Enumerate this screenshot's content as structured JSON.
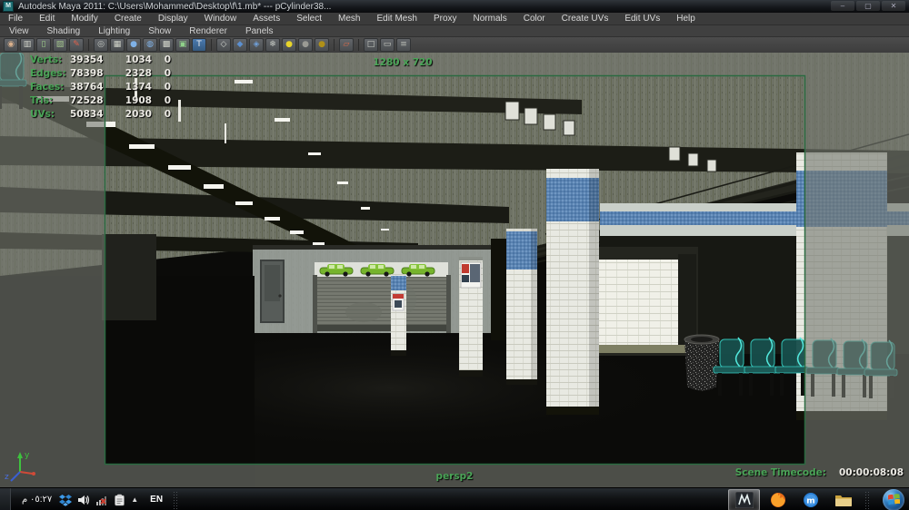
{
  "window": {
    "title": "Autodesk Maya 2011: C:\\Users\\Mohammed\\Desktop\\f\\1.mb*   ---   pCylinder38...",
    "app_icon": "maya-app-icon",
    "app_icon_letter": "M",
    "caption_buttons": [
      "minimize",
      "maximize",
      "close"
    ]
  },
  "menu_bar": {
    "items": [
      "File",
      "Edit",
      "Modify",
      "Create",
      "Display",
      "Window",
      "Assets",
      "Select",
      "Mesh",
      "Edit Mesh",
      "Proxy",
      "Normals",
      "Color",
      "Create UVs",
      "Edit UVs",
      "Help"
    ]
  },
  "panel_menu_bar": {
    "items": [
      "View",
      "Shading",
      "Lighting",
      "Show",
      "Renderer",
      "Panels"
    ]
  },
  "panel_toolbar": {
    "icons": [
      {
        "name": "select-camera-icon",
        "glyph": "◉",
        "fg": "#d9b08c"
      },
      {
        "name": "camera-attributes-icon",
        "glyph": "▥",
        "fg": "#cfd2c8"
      },
      {
        "name": "bookmarks-icon",
        "glyph": "▯",
        "fg": "#9fd08a"
      },
      {
        "name": "image-plane-icon",
        "glyph": "▧",
        "fg": "#9fc08a"
      },
      {
        "name": "grease-pencil-icon",
        "glyph": "✎",
        "fg": "#e0604a"
      },
      {
        "sep": true
      },
      {
        "name": "wireframe-icon",
        "glyph": "◎",
        "fg": "#c8ccc6"
      },
      {
        "name": "film-gate-icon",
        "glyph": "▦",
        "fg": "#cfd2c8"
      },
      {
        "name": "smooth-shade-icon",
        "glyph": "●",
        "fg": "#7fb2e8"
      },
      {
        "name": "shade-textured-icon",
        "glyph": "◍",
        "fg": "#7fb2e8"
      },
      {
        "name": "xray-icon",
        "glyph": "▩",
        "fg": "#cfd2c8"
      },
      {
        "name": "default-material-icon",
        "glyph": "▣",
        "fg": "#8fd08a"
      },
      {
        "name": "textured-icon",
        "glyph": "T",
        "fg": "#eeeeee"
      },
      {
        "sep": true
      },
      {
        "name": "wire-cube-icon",
        "glyph": "◇",
        "fg": "#d0d4ce"
      },
      {
        "name": "shaded-cube-icon",
        "glyph": "◆",
        "fg": "#5b8fd0"
      },
      {
        "name": "textured-cube-icon",
        "glyph": "◈",
        "fg": "#6f9fd8"
      },
      {
        "name": "occlusion-icon",
        "glyph": "❄",
        "fg": "#c8ccc6"
      },
      {
        "name": "all-lights-icon",
        "glyph": "●",
        "fg": "#e8d42a"
      },
      {
        "name": "no-lights-icon",
        "glyph": "●",
        "fg": "#9a9a94"
      },
      {
        "name": "selected-lights-icon",
        "glyph": "●",
        "fg": "#b09018"
      },
      {
        "sep": true
      },
      {
        "name": "isolate-select-icon",
        "glyph": "▱",
        "fg": "#d86a4a"
      },
      {
        "sep": true
      },
      {
        "name": "field-chart-icon",
        "glyph": "□",
        "fg": "#c9ccc4"
      },
      {
        "name": "safe-action-icon",
        "glyph": "▭",
        "fg": "#c9ccc4"
      },
      {
        "name": "multi-pane-icon",
        "glyph": "≡",
        "fg": "#b8bcb4"
      }
    ]
  },
  "viewport": {
    "hud": {
      "stats_rows": [
        {
          "label": "Verts:",
          "total": "39354",
          "selected": "1034",
          "extra": "0"
        },
        {
          "label": "Edges:",
          "total": "78398",
          "selected": "2328",
          "extra": "0"
        },
        {
          "label": "Faces:",
          "total": "38764",
          "selected": "1374",
          "extra": "0"
        },
        {
          "label": "Tris:",
          "total": "72528",
          "selected": "1908",
          "extra": "0"
        },
        {
          "label": "UVs:",
          "total": "50834",
          "selected": "2030",
          "extra": "0"
        }
      ],
      "resolution_gate_label": "1280 x 720",
      "camera_name": "persp2",
      "timecode_label": "Scene Timecode:",
      "timecode_value": "00:00:08:08"
    },
    "axis_gizmo": {
      "y_label": "y",
      "z_label": "z"
    },
    "colors": {
      "hud_green": "#4aa457",
      "hud_white": "#eceae4",
      "gate_border": "#2a6a40",
      "pillar_blue_band": "#5a83b1",
      "bench_teal": "#1e5f5c",
      "bench_highlight": "#4fe0d4",
      "car_green": "#76b42c"
    }
  },
  "taskbar": {
    "show_desktop": "show-desktop-button",
    "clock": "٠٥:٢٧ م",
    "language_indicator": "EN",
    "tray_icons": [
      "dropbox-icon",
      "volume-icon",
      "network-error-icon",
      "action-center-icon",
      "show-hidden-icons-chevron"
    ],
    "apps": [
      {
        "name": "maya-taskbar-button",
        "active": true
      },
      {
        "name": "firefox-taskbar-button",
        "active": false
      },
      {
        "name": "maxthon-taskbar-button",
        "active": false
      },
      {
        "name": "explorer-taskbar-button",
        "active": false
      }
    ],
    "maxthon_letter": "m",
    "start": "start-button"
  }
}
